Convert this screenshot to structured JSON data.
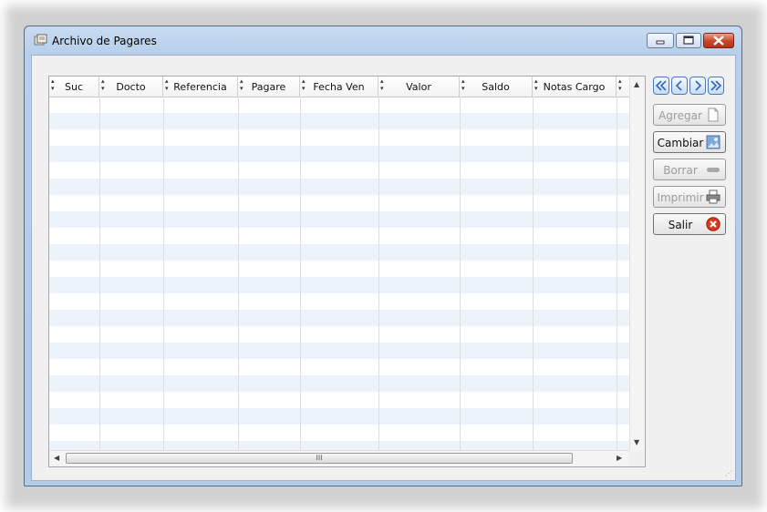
{
  "window": {
    "title": "Archivo de Pagares",
    "controls": {
      "minimize": "minimize",
      "maximize": "maximize",
      "close": "close"
    }
  },
  "grid": {
    "columns": [
      "Suc",
      "Docto",
      "Referencia",
      "Pagare",
      "Fecha Ven",
      "Valor",
      "Saldo",
      "Notas Cargo"
    ],
    "rows": [],
    "scrollbar_grip": "III"
  },
  "buttons": {
    "agregar": "Agregar",
    "cambiar": "Cambiar",
    "borrar": "Borrar",
    "imprimir": "Imprimir",
    "salir": "Salir"
  },
  "colors": {
    "accent": "#4a79c4",
    "row_alt": "#ecf3fb",
    "close_red": "#d9381e"
  }
}
